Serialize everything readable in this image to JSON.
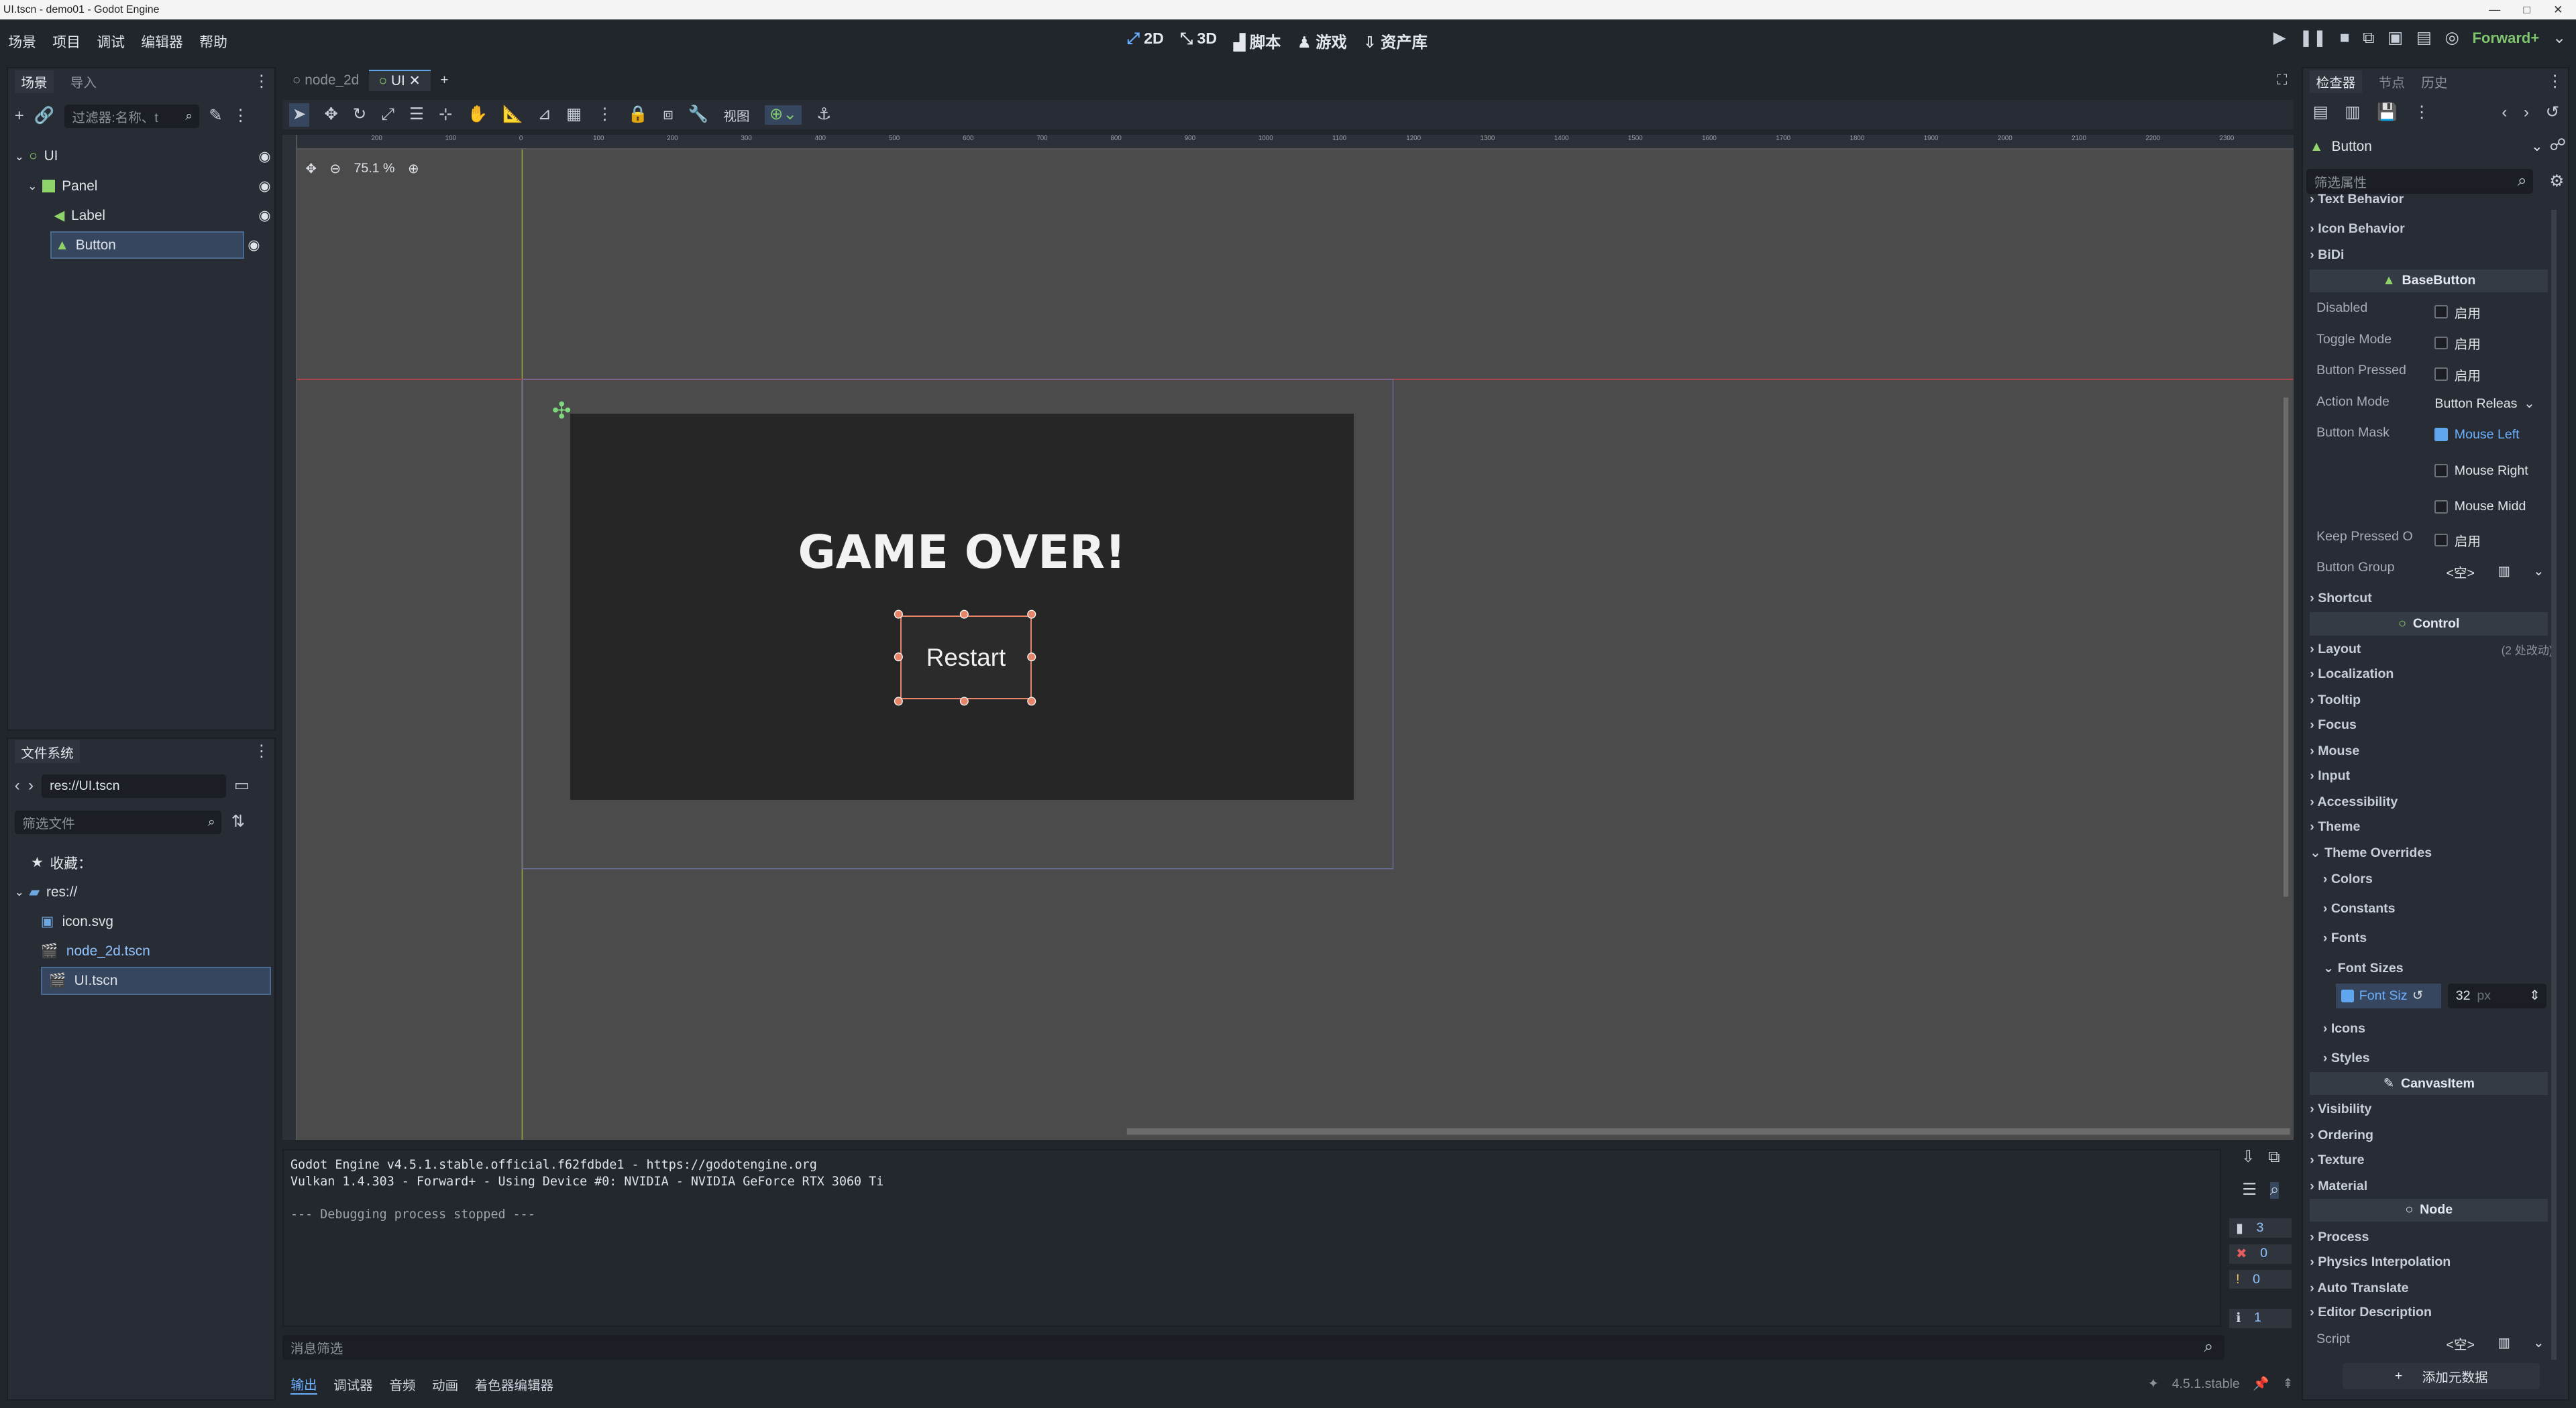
{
  "window": {
    "title": "UI.tscn - demo01 - Godot Engine"
  },
  "menu": [
    "场景",
    "项目",
    "调试",
    "编辑器",
    "帮助"
  ],
  "workspaces": [
    {
      "label": "2D",
      "active": true
    },
    {
      "label": "3D"
    },
    {
      "label": "脚本"
    },
    {
      "label": "游戏"
    },
    {
      "label": "资产库"
    }
  ],
  "renderer": "Forward+",
  "scene_dock": {
    "tabs": [
      "场景",
      "导入"
    ],
    "filter_placeholder": "过滤器:名称、t",
    "nodes": [
      {
        "name": "UI",
        "type": "Control",
        "depth": 0
      },
      {
        "name": "Panel",
        "type": "Panel",
        "depth": 1
      },
      {
        "name": "Label",
        "type": "Label",
        "depth": 2
      },
      {
        "name": "Button",
        "type": "Button",
        "depth": 2,
        "selected": true
      }
    ]
  },
  "filesystem": {
    "title": "文件系统",
    "path": "res://UI.tscn",
    "filter_placeholder": "筛选文件",
    "favorites_label": "收藏：",
    "root": "res://",
    "files": [
      {
        "name": "icon.svg"
      },
      {
        "name": "node_2d.tscn",
        "highlight": true
      },
      {
        "name": "UI.tscn",
        "selected": true
      }
    ]
  },
  "editor_tabs": [
    {
      "label": "node_2d",
      "active": false
    },
    {
      "label": "UI",
      "active": true
    }
  ],
  "toolbar": {
    "view_label": "视图"
  },
  "viewport": {
    "zoom": "75.1 %",
    "ruler_ticks": [
      "200",
      "100",
      "0",
      "100",
      "200",
      "300",
      "400",
      "500",
      "600",
      "700",
      "800",
      "900",
      "1000",
      "1100",
      "1200",
      "1300",
      "1400",
      "1500",
      "1600",
      "1700",
      "1800",
      "1900",
      "2000",
      "2100",
      "2200",
      "2300"
    ],
    "label_text": "GAME OVER!",
    "button_text": "Restart"
  },
  "output": {
    "lines": [
      "Godot Engine v4.5.1.stable.official.f62fdbde1 - https://godotengine.org",
      "Vulkan 1.4.303 - Forward+ - Using Device #0: NVIDIA - NVIDIA GeForce RTX 3060 Ti",
      "",
      "--- Debugging process stopped ---"
    ],
    "filter_placeholder": "消息筛选",
    "counts": {
      "log": "3",
      "errors": "0",
      "warnings": "0",
      "info": "1"
    }
  },
  "bottom_tabs": [
    "输出",
    "调试器",
    "音频",
    "动画",
    "着色器编辑器"
  ],
  "version": "4.5.1.stable",
  "inspector": {
    "tabs": [
      "检查器",
      "节点",
      "历史"
    ],
    "node_name": "Button",
    "filter_placeholder": "筛选属性",
    "top_groups": [
      "Text Behavior",
      "Icon Behavior",
      "BiDi"
    ],
    "section_basebutton": "BaseButton",
    "props": [
      {
        "k": "Disabled",
        "v": "启用"
      },
      {
        "k": "Toggle Mode",
        "v": "启用"
      },
      {
        "k": "Button Pressed",
        "v": "启用"
      },
      {
        "k": "Action Mode",
        "v": "Button Releas"
      },
      {
        "k": "Button Mask",
        "v": "Mouse Left"
      },
      {
        "k": "",
        "v": "Mouse Right"
      },
      {
        "k": "",
        "v": "Mouse Midd"
      },
      {
        "k": "Keep Pressed O",
        "v": "启用"
      },
      {
        "k": "Button Group",
        "v": "<空>"
      }
    ],
    "shortcut": "Shortcut",
    "section_control": "Control",
    "control_groups": [
      "Layout",
      "Localization",
      "Tooltip",
      "Focus",
      "Mouse",
      "Input",
      "Accessibility",
      "Theme",
      "Theme Overrides"
    ],
    "layout_note": "(2 处改动)",
    "override_groups": [
      "Colors",
      "Constants",
      "Fonts",
      "Font Sizes",
      "Icons",
      "Styles"
    ],
    "font_size": {
      "label": "Font Siz",
      "value": "32",
      "unit": "px"
    },
    "section_canvasitem": "CanvasItem",
    "canvas_groups": [
      "Visibility",
      "Ordering",
      "Texture",
      "Material"
    ],
    "section_node": "Node",
    "node_groups": [
      "Process",
      "Physics Interpolation",
      "Auto Translate",
      "Editor Description"
    ],
    "script_label": "Script",
    "script_value": "<空>",
    "add_metadata": "添加元数据"
  }
}
